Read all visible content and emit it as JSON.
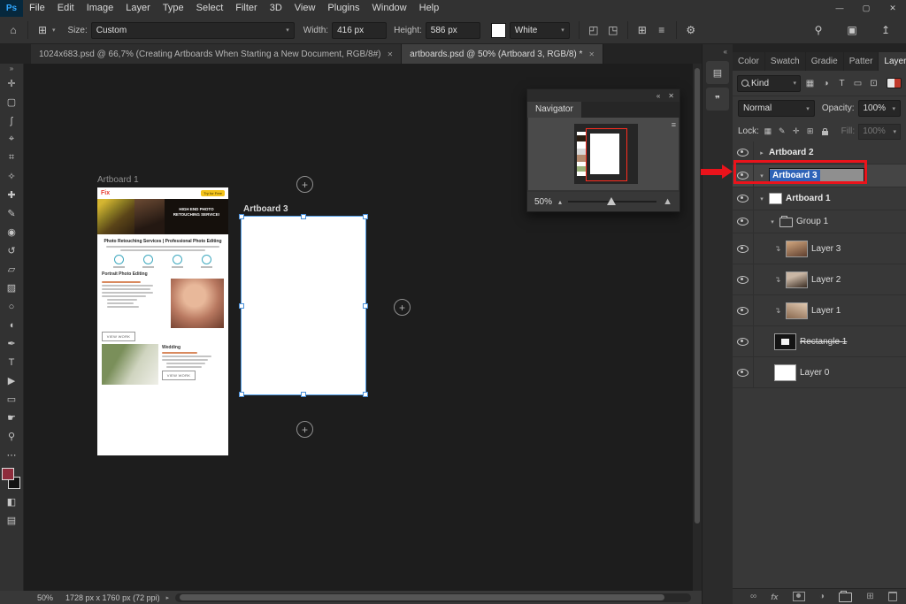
{
  "colors": {
    "annotation_red": "#ea131b",
    "selection_blue": "#2e63b8",
    "ps_logo_blue": "#31a8ff"
  },
  "menubar": {
    "logo": "Ps",
    "items": [
      "File",
      "Edit",
      "Image",
      "Layer",
      "Type",
      "Select",
      "Filter",
      "3D",
      "View",
      "Plugins",
      "Window",
      "Help"
    ],
    "window_controls": {
      "minimize": "—",
      "maximize": "▢",
      "close": "✕"
    }
  },
  "options_bar": {
    "size_label": "Size:",
    "size_value": "Custom",
    "width_label": "Width:",
    "width_value": "416 px",
    "height_label": "Height:",
    "height_value": "586 px",
    "bg_value": "White"
  },
  "doc_tabs": [
    {
      "label": "1024x683.psd @ 66,7% (Creating Artboards When Starting a New Document, RGB/8#)"
    },
    {
      "label": "artboards.psd @ 50% (Artboard 3, RGB/8) *"
    }
  ],
  "toolbar": {
    "tools": [
      {
        "name": "move-tool",
        "glyph": "✛"
      },
      {
        "name": "marquee-tool",
        "glyph": "▢"
      },
      {
        "name": "lasso-tool",
        "glyph": "ʃ"
      },
      {
        "name": "quick-selection-tool",
        "glyph": "⌖"
      },
      {
        "name": "crop-tool",
        "glyph": "⌗"
      },
      {
        "name": "eyedropper-tool",
        "glyph": "✧"
      },
      {
        "name": "healing-brush-tool",
        "glyph": "✚"
      },
      {
        "name": "brush-tool",
        "glyph": "✎"
      },
      {
        "name": "clone-stamp-tool",
        "glyph": "◉"
      },
      {
        "name": "history-brush-tool",
        "glyph": "↺"
      },
      {
        "name": "eraser-tool",
        "glyph": "▱"
      },
      {
        "name": "gradient-tool",
        "glyph": "▨"
      },
      {
        "name": "blur-tool",
        "glyph": "○"
      },
      {
        "name": "dodge-tool",
        "glyph": "◖"
      },
      {
        "name": "pen-tool",
        "glyph": "✒"
      },
      {
        "name": "type-tool",
        "glyph": "T"
      },
      {
        "name": "path-selection-tool",
        "glyph": "▶"
      },
      {
        "name": "rectangle-tool",
        "glyph": "▭"
      },
      {
        "name": "hand-tool",
        "glyph": "☛"
      },
      {
        "name": "zoom-tool",
        "glyph": "⚲"
      },
      {
        "name": "more-tools",
        "glyph": "⋯"
      },
      {
        "name": "quick-mask-tool",
        "glyph": "◧"
      },
      {
        "name": "screen-mode-tool",
        "glyph": "▤"
      }
    ]
  },
  "canvas": {
    "artboard1_label": "Artboard 1",
    "artboard3_label": "Artboard 3",
    "mock": {
      "logo": "Fix",
      "try_free": "Try for Free",
      "headline": "HIGH END PHOTO RETOUCHING SERVICE!",
      "subheadline": "Photo Retouching Services | Professional Photo Editing",
      "portrait_heading": "Portrait Photo Editing",
      "wedding_heading": "Wedding",
      "view_work": "VIEW WORK"
    }
  },
  "navigator": {
    "title": "Navigator",
    "zoom": "50%"
  },
  "right_panel": {
    "tabs": [
      "Color",
      "Swatch",
      "Gradie",
      "Patter",
      "Layers"
    ],
    "kind_label": "Kind",
    "blend_mode": "Normal",
    "opacity_label": "Opacity:",
    "opacity_value": "100%",
    "lock_label": "Lock:",
    "fill_label": "Fill:",
    "fill_value": "100%",
    "layers": [
      {
        "name": "Artboard 2"
      },
      {
        "name": "Artboard 3"
      },
      {
        "name": "Artboard 1"
      },
      {
        "name": "Group 1"
      },
      {
        "name": "Layer 3"
      },
      {
        "name": "Layer 2"
      },
      {
        "name": "Layer 1"
      },
      {
        "name": "Rectangle 1"
      },
      {
        "name": "Layer 0"
      }
    ],
    "footer_fx": "fx"
  },
  "status_bar": {
    "zoom": "50%",
    "doc_info": "1728 px x 1760 px (72 ppi)"
  },
  "icons": {
    "home": "⌂",
    "artboard_tool": "⊞",
    "dropdown": "▾",
    "chevron_right": "▸",
    "straighten_a": "◰",
    "straighten_b": "◳",
    "grid": "⊞",
    "align": "≡",
    "gear": "⚙",
    "search": "⚲",
    "workspace": "▣",
    "share": "↥",
    "collapse": "»",
    "expand": "«",
    "plus": "+",
    "menu": "≡",
    "properties": "▤",
    "comment": "❞",
    "close": "✕",
    "pixel_filter": "▦",
    "adjustment": "◑",
    "type_filter": "T",
    "shape_filter": "▭",
    "smart_filter": "⊡",
    "lock_transparent": "▦",
    "lock_brush": "✎",
    "lock_move": "✛",
    "lock_artboard": "⊞",
    "clip": "↴",
    "link": "∞",
    "new_layer": "⊞",
    "nav_zoom_out": "▴",
    "nav_zoom_in": "▲",
    "scroll_chevron": "▸",
    "ellipsis": "⋯"
  }
}
